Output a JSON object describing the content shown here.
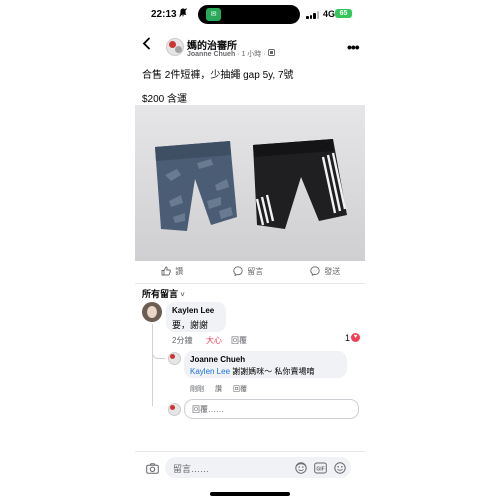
{
  "status": {
    "time": "22:13",
    "network": "4G",
    "battery": "65"
  },
  "header": {
    "group_name": "媽的治審所",
    "author": "Joanne Chueh",
    "time_ago": "1 小時"
  },
  "post": {
    "text": "合售 2件短褲，少抽繩 gap 5y, 7號",
    "price": "$200 含運"
  },
  "actions": {
    "like": "讚",
    "comment": "留言",
    "share": "發送"
  },
  "comments_header": "所有留言",
  "comment": {
    "name": "Kaylen Lee",
    "text": "要，謝謝",
    "time": "2分鐘",
    "reaction": "大心",
    "reply": "回覆",
    "reaction_count": "1"
  },
  "reply": {
    "name": "Joanne Chueh",
    "mention": "Kaylen Lee",
    "text": " 謝謝媽咪～ 私你賣場唷",
    "time": "剛剛",
    "like": "讚",
    "reply": "回覆"
  },
  "reply_input": {
    "placeholder": "回覆……"
  },
  "comment_input": {
    "placeholder": "留言……"
  },
  "colors": {
    "link": "#1b74e4",
    "love": "#f33e58",
    "muted": "#65676b",
    "bubble": "#f0f2f5",
    "battery": "#34c759"
  }
}
